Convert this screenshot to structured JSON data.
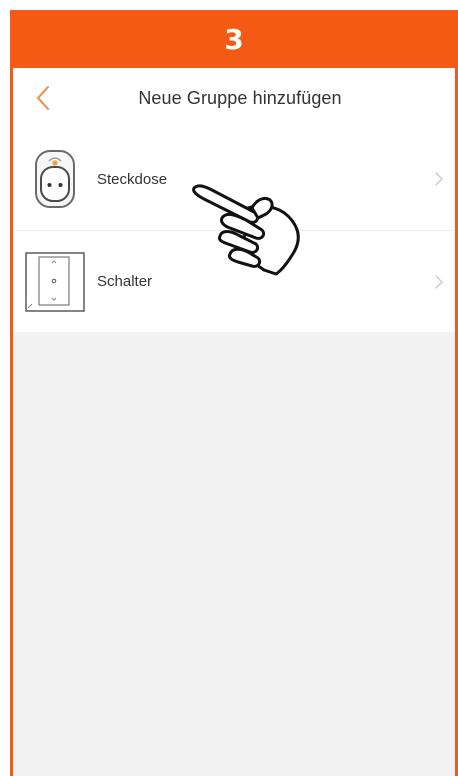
{
  "step": {
    "number": "3",
    "color": "#f55a14"
  },
  "nav": {
    "title": "Neue Gruppe hinzufügen",
    "back_icon": "chevron-left-icon",
    "accent": "#f08a3c"
  },
  "items": [
    {
      "label": "Steckdose",
      "icon": "socket-plug-icon",
      "chevron": "chevron-right-icon"
    },
    {
      "label": "Schalter",
      "icon": "wall-switch-icon",
      "chevron": "chevron-right-icon"
    }
  ],
  "overlay": {
    "icon": "pointing-hand-icon"
  },
  "colors": {
    "background": "#f2f2f2",
    "text": "#333333",
    "chevron": "#c8c8c8",
    "socket_dot": "#f39a3a"
  }
}
